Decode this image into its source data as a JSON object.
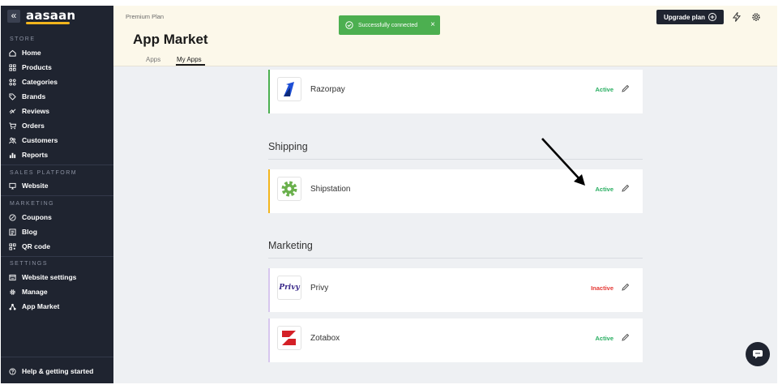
{
  "sidebar": {
    "collapse_icon": "double-chevron-left-icon",
    "logo_text": "aasaan",
    "sections": [
      {
        "label": "STORE",
        "items": [
          {
            "label": "Home",
            "icon": "home-icon"
          },
          {
            "label": "Products",
            "icon": "grid-icon"
          },
          {
            "label": "Categories",
            "icon": "categories-icon"
          },
          {
            "label": "Brands",
            "icon": "tag-icon"
          },
          {
            "label": "Reviews",
            "icon": "thumbs-icon"
          },
          {
            "label": "Orders",
            "icon": "cart-icon"
          },
          {
            "label": "Customers",
            "icon": "users-icon"
          },
          {
            "label": "Reports",
            "icon": "bar-chart-icon"
          }
        ]
      },
      {
        "label": "SALES PLATFORM",
        "items": [
          {
            "label": "Website",
            "icon": "monitor-icon"
          }
        ]
      },
      {
        "label": "MARKETING",
        "items": [
          {
            "label": "Coupons",
            "icon": "coupon-icon"
          },
          {
            "label": "Blog",
            "icon": "blog-icon"
          },
          {
            "label": "QR code",
            "icon": "qr-icon"
          }
        ]
      },
      {
        "label": "SETTINGS",
        "items": [
          {
            "label": "Website settings",
            "icon": "browser-icon"
          },
          {
            "label": "Manage",
            "icon": "gear-icon"
          },
          {
            "label": "App Market",
            "icon": "app-market-icon"
          }
        ]
      }
    ],
    "help": {
      "label": "Help & getting started",
      "icon": "help-icon"
    }
  },
  "header": {
    "plan": "Premium Plan",
    "title": "App Market",
    "tabs": [
      {
        "label": "Apps",
        "active": false
      },
      {
        "label": "My Apps",
        "active": true
      }
    ],
    "upgrade_label": "Upgrade plan",
    "icons": [
      "lightning-icon",
      "gear-icon"
    ]
  },
  "toast": {
    "message": "Successfully connected",
    "icon": "check-circle-icon",
    "close": "×"
  },
  "sections": [
    {
      "title": "",
      "apps": [
        {
          "name": "Razorpay",
          "status": "Active",
          "accent": "#4caf50",
          "logo": "razorpay-logo"
        }
      ]
    },
    {
      "title": "Shipping",
      "apps": [
        {
          "name": "Shipstation",
          "status": "Active",
          "accent": "#f2b51d",
          "logo": "shipstation-logo"
        }
      ]
    },
    {
      "title": "Marketing",
      "apps": [
        {
          "name": "Privy",
          "status": "Inactive",
          "accent": "#d7c7ee",
          "logo": "privy-logo",
          "logo_text": "Privy"
        },
        {
          "name": "Zotabox",
          "status": "Active",
          "accent": "#d7c7ee",
          "logo": "zotabox-logo"
        }
      ]
    }
  ],
  "colors": {
    "active": "#27ae60",
    "inactive": "#e53935",
    "sidebar_bg": "#1f2430",
    "header_bg": "#fcf8ea",
    "toast_bg": "#4caf50",
    "brand_underline": "#f2b51d"
  }
}
